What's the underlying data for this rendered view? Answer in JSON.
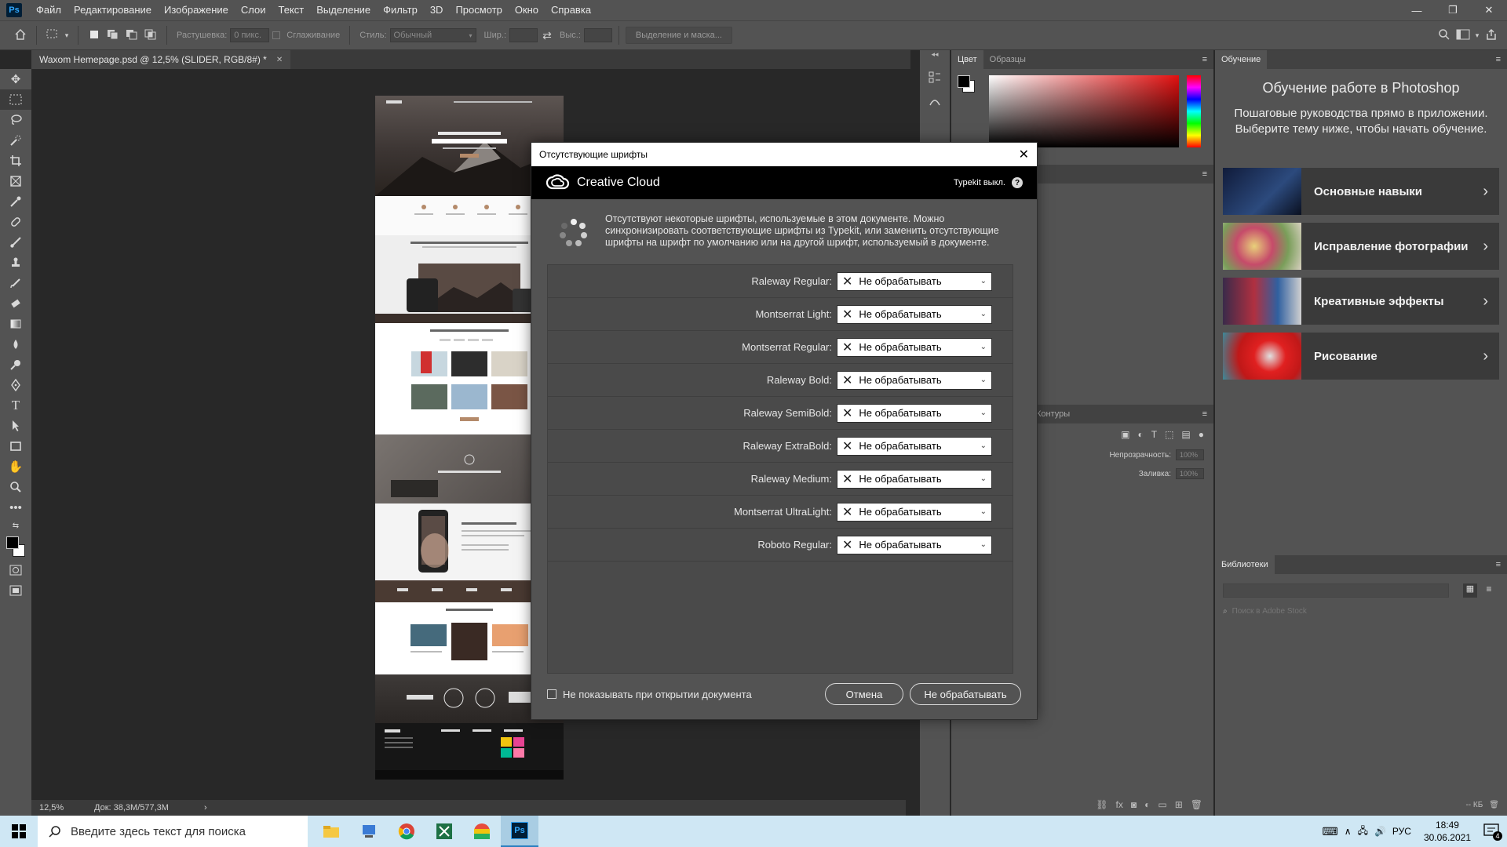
{
  "menubar": {
    "logo": "Ps",
    "items": [
      "Файл",
      "Редактирование",
      "Изображение",
      "Слои",
      "Текст",
      "Выделение",
      "Фильтр",
      "3D",
      "Просмотр",
      "Окно",
      "Справка"
    ],
    "win_min": "—",
    "win_restore": "❐",
    "win_close": "✕"
  },
  "options": {
    "feather_label": "Растушевка:",
    "feather_value": "0 пикс.",
    "antialias_label": "Сглаживание",
    "style_label": "Стиль:",
    "style_value": "Обычный",
    "width_label": "Шир.:",
    "height_label": "Выс.:",
    "select_mask_button": "Выделение и маска..."
  },
  "document": {
    "tab_title": "Waxom Hemepage.psd @ 12,5% (SLIDER, RGB/8#) *",
    "tab_close": "✕"
  },
  "statusbar": {
    "zoom": "12,5%",
    "doc_info": "Док: 38,3M/577,3M",
    "arrow": "›"
  },
  "panels": {
    "color_tab": "Цвет",
    "swatches_tab": "Образцы",
    "contours_tab": "Контуры",
    "opacity_label": "Непрозрачность:",
    "opacity_value": "100%",
    "fill_label": "Заливка:",
    "fill_value": "100%",
    "libraries_tab": "Библиотеки",
    "search_stock_placeholder": "Поиск в Adobe Stock",
    "libraries_size": "-- КБ"
  },
  "learn": {
    "tab": "Обучение",
    "title": "Обучение работе в Photoshop",
    "subtitle": "Пошаговые руководства прямо в приложении. Выберите тему ниже, чтобы начать обучение.",
    "cards": [
      {
        "label": "Основные навыки"
      },
      {
        "label": "Исправление фотографии"
      },
      {
        "label": "Креативные эффекты"
      },
      {
        "label": "Рисование"
      }
    ]
  },
  "dialog": {
    "title": "Отсутствующие шрифты",
    "cc_name": "Creative Cloud",
    "typekit_status": "Typekit выкл.",
    "help": "?",
    "message": "Отсутствуют некоторые шрифты, используемые в этом документе. Можно синхронизировать соответствующие шрифты из Typekit, или заменить отсутствующие шрифты на шрифт по умолчанию или на другой шрифт, используемый в документе.",
    "fonts": [
      {
        "name": "Raleway Regular:",
        "action": "Не обрабатывать"
      },
      {
        "name": "Montserrat Light:",
        "action": "Не обрабатывать"
      },
      {
        "name": "Montserrat Regular:",
        "action": "Не обрабатывать"
      },
      {
        "name": "Raleway Bold:",
        "action": "Не обрабатывать"
      },
      {
        "name": "Raleway SemiBold:",
        "action": "Не обрабатывать"
      },
      {
        "name": "Raleway ExtraBold:",
        "action": "Не обрабатывать"
      },
      {
        "name": "Raleway Medium:",
        "action": "Не обрабатывать"
      },
      {
        "name": "Montserrat UltraLight:",
        "action": "Не обрабатывать"
      },
      {
        "name": "Roboto Regular:",
        "action": "Не обрабатывать"
      }
    ],
    "dont_show_label": "Не показывать при открытии документа",
    "cancel_button": "Отмена",
    "dont_process_button": "Не обрабатывать"
  },
  "taskbar": {
    "search_placeholder": "Введите здесь текст для поиска",
    "language": "РУС",
    "time": "18:49",
    "date": "30.06.2021",
    "notifications": "4"
  },
  "colors": {
    "accent": "#31a8ff",
    "taskbar": "#cfe7f4",
    "panel": "#535353"
  }
}
